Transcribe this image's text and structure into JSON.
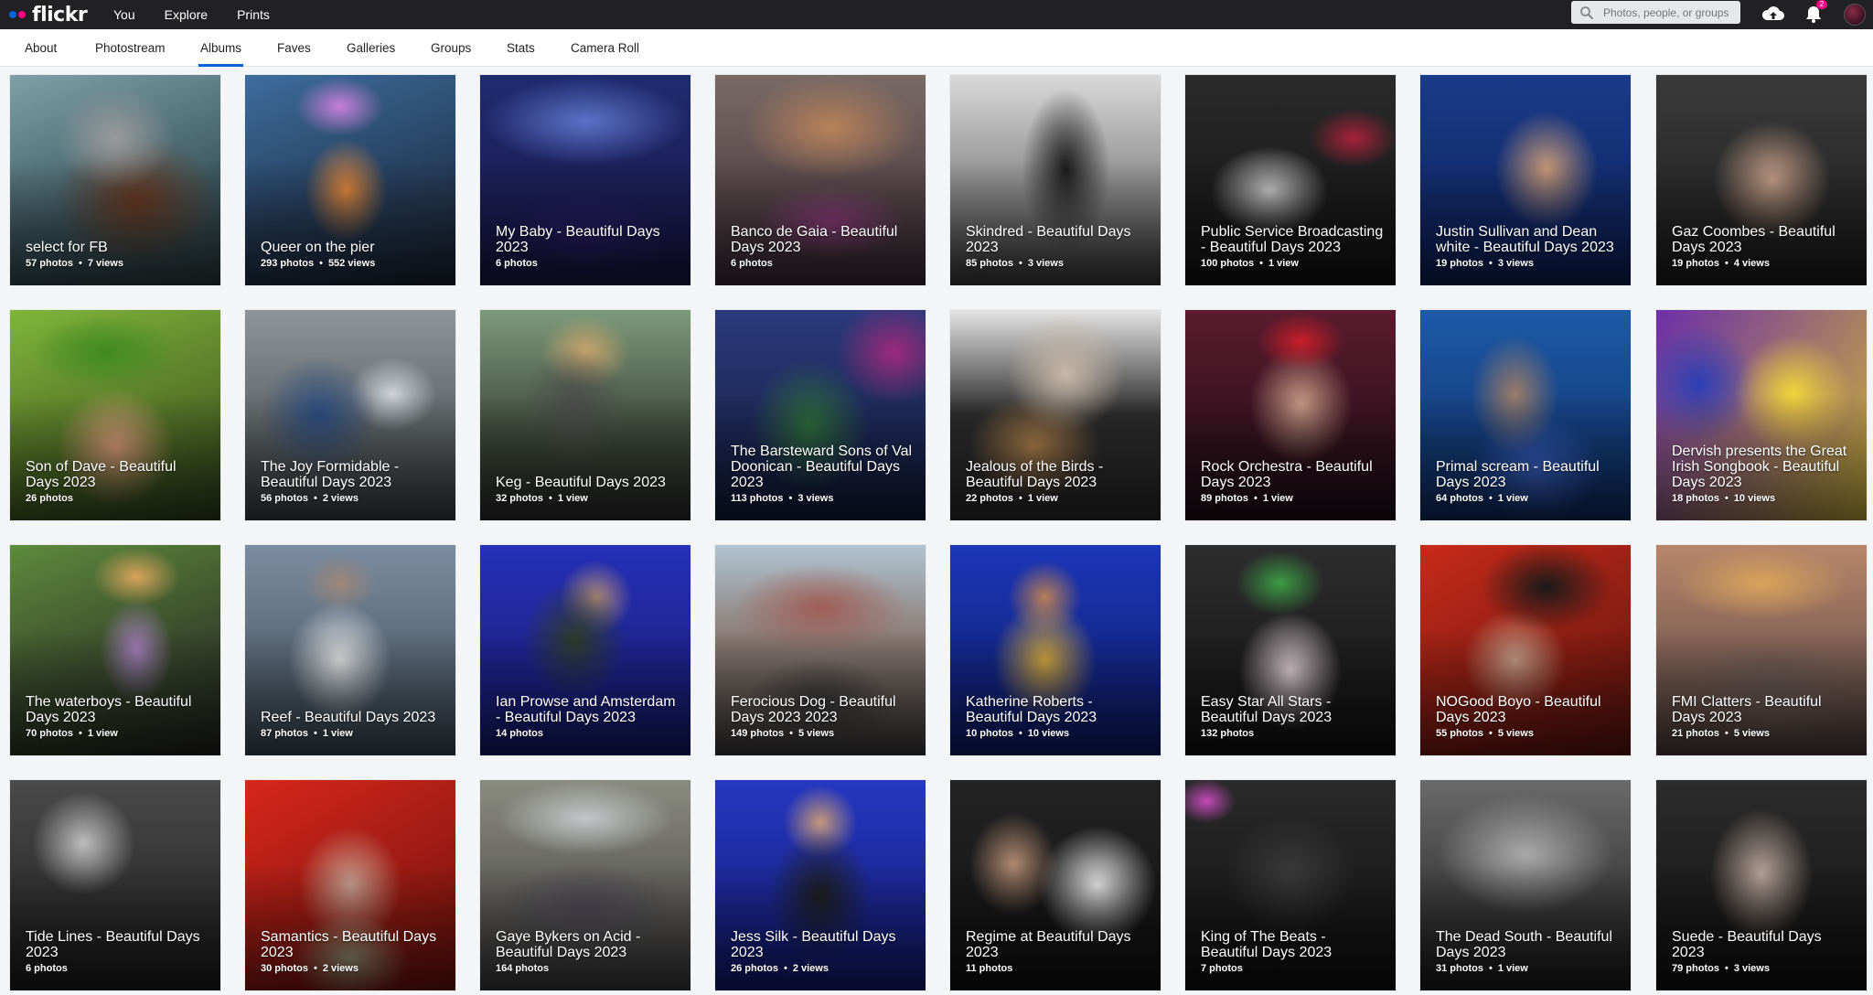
{
  "topbar": {
    "logo": "flickr",
    "nav": [
      "You",
      "Explore",
      "Prints"
    ],
    "search_placeholder": "Photos, people, or groups",
    "notification_count": "2"
  },
  "subnav": {
    "tabs": [
      "About",
      "Photostream",
      "Albums",
      "Faves",
      "Galleries",
      "Groups",
      "Stats",
      "Camera Roll"
    ],
    "active": "Albums"
  },
  "albums": [
    {
      "title": "select for FB",
      "photos": "57 photos",
      "views": "7 views"
    },
    {
      "title": "Queer on the pier",
      "photos": "293 photos",
      "views": "552 views"
    },
    {
      "title": "My Baby - Beautiful Days 2023",
      "photos": "6 photos",
      "views": ""
    },
    {
      "title": "Banco de Gaia - Beautiful Days 2023",
      "photos": "6 photos",
      "views": ""
    },
    {
      "title": "Skindred - Beautiful Days 2023",
      "photos": "85 photos",
      "views": "3 views"
    },
    {
      "title": "Public Service Broadcasting - Beautiful Days 2023",
      "photos": "100 photos",
      "views": "1 view"
    },
    {
      "title": "Justin Sullivan and Dean white - Beautiful Days 2023",
      "photos": "19 photos",
      "views": "3 views"
    },
    {
      "title": "Gaz Coombes - Beautiful Days 2023",
      "photos": "19 photos",
      "views": "4 views"
    },
    {
      "title": "Son of Dave - Beautiful Days 2023",
      "photos": "26 photos",
      "views": ""
    },
    {
      "title": "The Joy Formidable - Beautiful Days 2023",
      "photos": "56 photos",
      "views": "2 views"
    },
    {
      "title": "Keg - Beautiful Days 2023",
      "photos": "32 photos",
      "views": "1 view"
    },
    {
      "title": "The Barsteward Sons of Val Doonican - Beautiful Days 2023",
      "photos": "113 photos",
      "views": "3 views"
    },
    {
      "title": "Jealous of the Birds - Beautiful Days 2023",
      "photos": "22 photos",
      "views": "1 view"
    },
    {
      "title": "Rock Orchestra - Beautiful Days 2023",
      "photos": "89 photos",
      "views": "1 view"
    },
    {
      "title": "Primal scream - Beautiful Days 2023",
      "photos": "64 photos",
      "views": "1 view"
    },
    {
      "title": "Dervish presents the Great Irish Songbook - Beautiful Days 2023",
      "photos": "18 photos",
      "views": "10 views"
    },
    {
      "title": "The waterboys - Beautiful Days 2023",
      "photos": "70 photos",
      "views": "1 view"
    },
    {
      "title": "Reef - Beautiful Days 2023",
      "photos": "87 photos",
      "views": "1 view"
    },
    {
      "title": "Ian Prowse and Amsterdam - Beautiful Days 2023",
      "photos": "14 photos",
      "views": ""
    },
    {
      "title": "Ferocious Dog - Beautiful Days 2023 2023",
      "photos": "149 photos",
      "views": "5 views"
    },
    {
      "title": "Katherine Roberts - Beautiful Days 2023",
      "photos": "10 photos",
      "views": "10 views"
    },
    {
      "title": "Easy Star All Stars - Beautiful Days 2023",
      "photos": "132 photos",
      "views": ""
    },
    {
      "title": "NOGood Boyo - Beautiful Days 2023",
      "photos": "55 photos",
      "views": "5 views"
    },
    {
      "title": "FMI Clatters - Beautiful Days 2023",
      "photos": "21 photos",
      "views": "5 views"
    },
    {
      "title": "Tide Lines - Beautiful Days 2023",
      "photos": "6 photos",
      "views": ""
    },
    {
      "title": "Samantics - Beautiful Days 2023",
      "photos": "30 photos",
      "views": "2 views"
    },
    {
      "title": "Gaye Bykers on Acid - Beautiful Days 2023",
      "photos": "164 photos",
      "views": ""
    },
    {
      "title": "Jess Silk - Beautiful Days 2023",
      "photos": "26 photos",
      "views": "2 views"
    },
    {
      "title": "Regime at Beautiful Days 2023",
      "photos": "11 photos",
      "views": ""
    },
    {
      "title": "King of The Beats - Beautiful Days 2023",
      "photos": "7 photos",
      "views": ""
    },
    {
      "title": "The Dead South - Beautiful Days 2023",
      "photos": "31 photos",
      "views": "1 view"
    },
    {
      "title": "Suede - Beautiful Days 2023",
      "photos": "79 photos",
      "views": "3 views"
    }
  ]
}
